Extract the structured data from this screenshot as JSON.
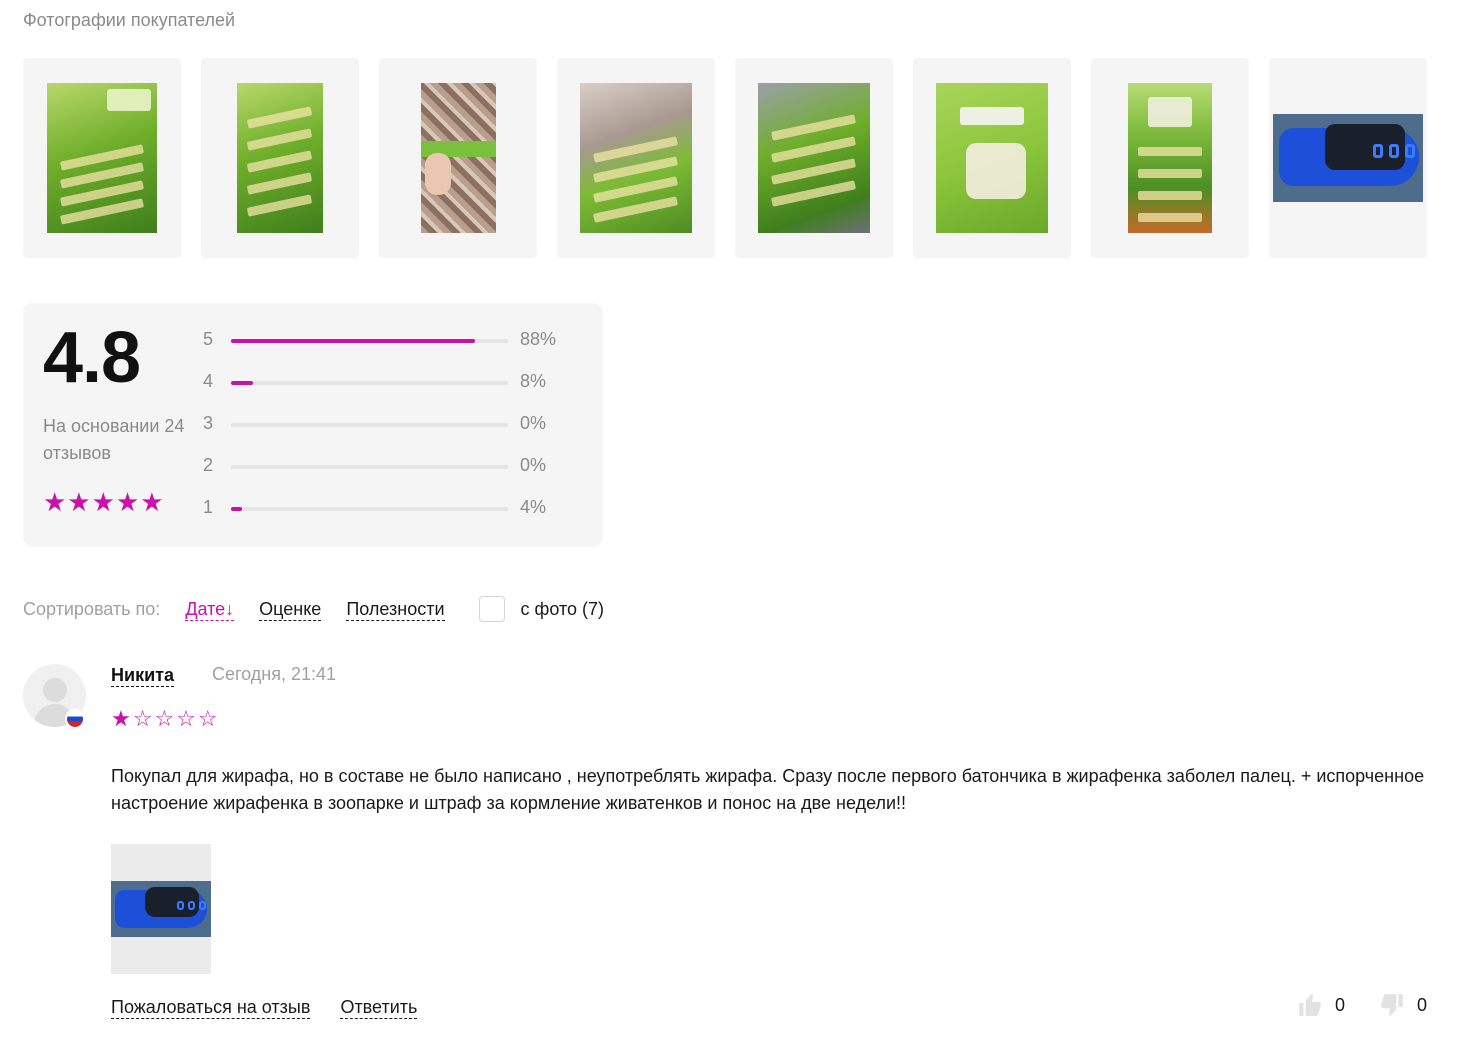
{
  "gallery": {
    "title": "Фотографии покупателей",
    "photos": [
      {
        "kind": "green"
      },
      {
        "kind": "green"
      },
      {
        "kind": "carpet"
      },
      {
        "kind": "green"
      },
      {
        "kind": "green"
      },
      {
        "kind": "green"
      },
      {
        "kind": "green"
      },
      {
        "kind": "shoe"
      }
    ]
  },
  "rating": {
    "average": "4.8",
    "based_on": "На основании 24 отзывов",
    "stars_text": "★★★★★",
    "distribution": [
      {
        "level": "5",
        "percent_label": "88%",
        "fraction": 0.88
      },
      {
        "level": "4",
        "percent_label": "8%",
        "fraction": 0.08
      },
      {
        "level": "3",
        "percent_label": "0%",
        "fraction": 0.0
      },
      {
        "level": "2",
        "percent_label": "0%",
        "fraction": 0.0
      },
      {
        "level": "1",
        "percent_label": "4%",
        "fraction": 0.04
      }
    ],
    "accent_color": "#cb11ab"
  },
  "sort": {
    "label": "Сортировать по:",
    "options": [
      {
        "label": "Дате↓",
        "active": true
      },
      {
        "label": "Оценке",
        "active": false
      },
      {
        "label": "Полезности",
        "active": false
      }
    ],
    "photo_filter_label": "с фото (7)",
    "photo_filter_checked": false
  },
  "review": {
    "author": "Никита",
    "date": "Сегодня, 21:41",
    "country_flag": "ru-flag-icon",
    "rating": 1,
    "stars_on": "★",
    "stars_off": "☆☆☆☆",
    "text": "Покупал для жирафа, но в составе не было написано , неупотреблять жирафа. Сразу после первого батончика в жирафенка заболел палец. + испорченное настроение жирафенка в зоопарке и штраф за кормление живатенков и понос на две недели!!",
    "complain_label": "Пожаловаться на отзыв",
    "reply_label": "Ответить",
    "likes": "0",
    "dislikes": "0"
  }
}
